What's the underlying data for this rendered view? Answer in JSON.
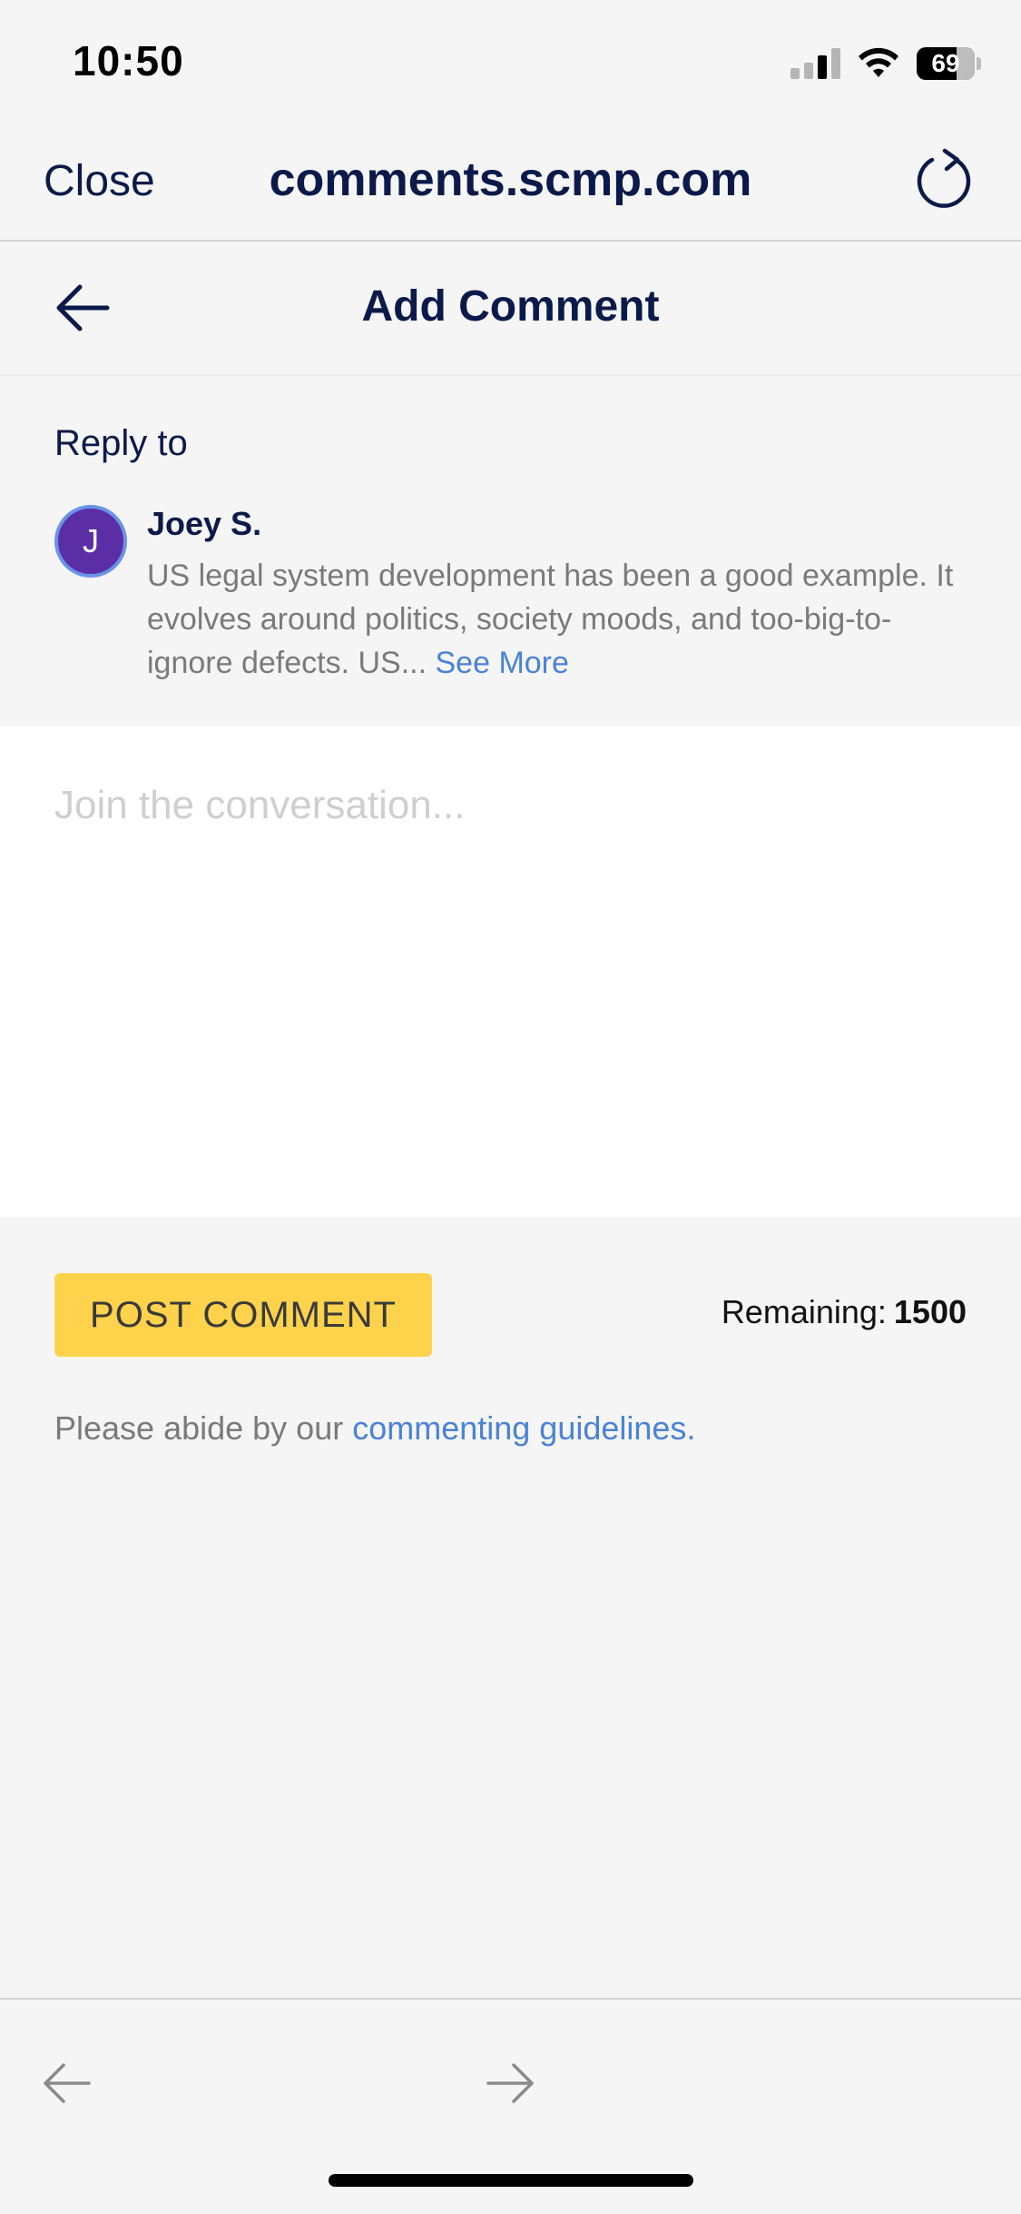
{
  "status_bar": {
    "time": "10:50",
    "battery": "69",
    "icons": [
      "signal-icon",
      "wifi-icon",
      "battery-icon"
    ]
  },
  "browser": {
    "close_label": "Close",
    "url": "comments.scmp.com",
    "reload_icon": "reload-icon"
  },
  "header": {
    "title": "Add Comment",
    "back_icon": "arrow-left-icon"
  },
  "reply": {
    "label": "Reply to",
    "avatar_letter": "J",
    "author": "Joey S.",
    "text": "US legal system development has been a good example.  It evolves around politics, society moods, and too-big-to-ignore defects.  US...",
    "see_more": "See More"
  },
  "composer": {
    "placeholder": "Join the conversation...",
    "value": ""
  },
  "actions": {
    "post_label": "POST COMMENT",
    "remaining_label": "Remaining:",
    "remaining_count": "1500"
  },
  "guidelines": {
    "prefix": "Please abide by our ",
    "link": "commenting guidelines",
    "suffix": "."
  },
  "colors": {
    "navy": "#0b1a4a",
    "accent_yellow": "#ffd24c",
    "link_blue": "#4a82d8",
    "avatar_purple": "#5b2ea6"
  }
}
